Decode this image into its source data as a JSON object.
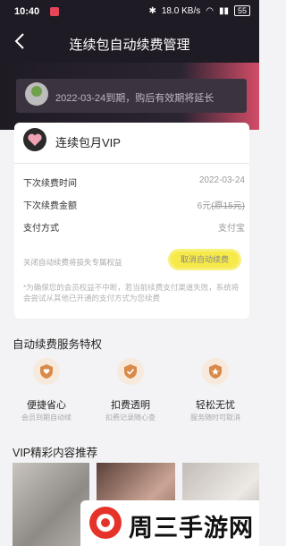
{
  "status_bar": {
    "time": "10:40",
    "network": "18.0 KB/s",
    "battery": "55"
  },
  "nav": {
    "title": "连续包自动续费管理"
  },
  "user_bar": {
    "text": "2022-03-24到期，购后有效期将延长"
  },
  "subscription": {
    "title": "连续包月VIP",
    "rows": [
      {
        "label": "下次续费时间",
        "value": "2022-03-24"
      },
      {
        "label": "下次续费金额",
        "value": "6元",
        "old_price": "(原15元)"
      },
      {
        "label": "支付方式",
        "value": "支付宝"
      }
    ],
    "cancel_hint": "关闭自动续费将损失专属权益",
    "cancel_button": "取消自动续费",
    "note": "*为确保您的会员权益不中断，若当前续费支付渠道失败，系统将会尝试从其他已开通的支付方式为您续费"
  },
  "privileges": {
    "title": "自动续费服务特权",
    "items": [
      {
        "name": "便捷省心",
        "desc": "会员到期自动续"
      },
      {
        "name": "扣费透明",
        "desc": "扣费记录随心查"
      },
      {
        "name": "轻松无忧",
        "desc": "服务随时可取消"
      }
    ]
  },
  "recommend": {
    "title": "VIP精彩内容推荐"
  },
  "watermark": {
    "text": "周三手游网"
  },
  "colors": {
    "header": "#1f1b24",
    "accent": "#e8455a",
    "highlight": "#f6e94a",
    "privilege_icon": "#d98a4a"
  }
}
